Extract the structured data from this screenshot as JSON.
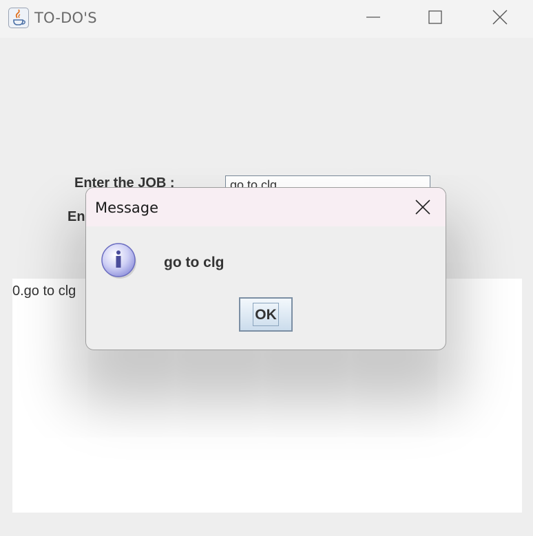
{
  "window": {
    "title": "TO-DO'S",
    "app_icon": "java-icon",
    "controls": [
      "minimize-icon",
      "maximize-icon",
      "close-icon"
    ]
  },
  "form": {
    "job_label": "Enter the JOB :",
    "second_label_partial": "En",
    "job_input_value": "go to clg"
  },
  "list": {
    "items": [
      "0.go to clg"
    ]
  },
  "dialog": {
    "title": "Message",
    "icon": "info-icon",
    "message": "go to clg",
    "ok_label": "OK",
    "close_icon": "close-icon"
  }
}
